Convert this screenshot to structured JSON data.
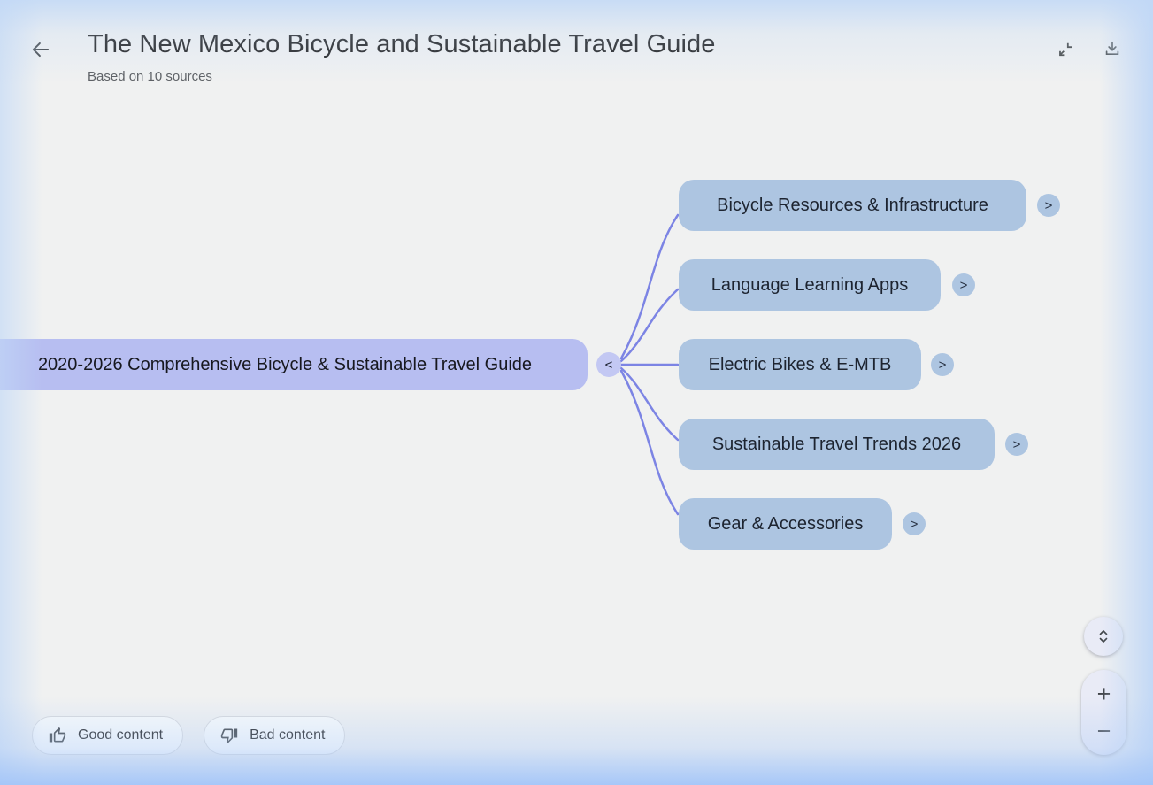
{
  "header": {
    "title": "The New Mexico Bicycle and Sustainable Travel Guide",
    "subtitle": "Based on 10 sources",
    "back_icon": "arrow-left",
    "collapse_icon": "collapse-content",
    "download_icon": "download"
  },
  "mindmap": {
    "root": {
      "label": "2020-2026 Comprehensive Bicycle & Sustainable Travel Guide",
      "collapse_glyph": "<"
    },
    "expand_glyph": ">",
    "children": [
      {
        "label": "Bicycle Resources & Infrastructure"
      },
      {
        "label": "Language Learning Apps"
      },
      {
        "label": "Electric Bikes & E-MTB"
      },
      {
        "label": "Sustainable Travel Trends 2026"
      },
      {
        "label": "Gear & Accessories"
      }
    ],
    "colors": {
      "root_bg": "#b7bef1",
      "child_bg": "#adc5e1",
      "connector": "#7c84e4"
    }
  },
  "feedback": {
    "good_label": "Good content",
    "bad_label": "Bad content",
    "good_icon": "thumb-up",
    "bad_icon": "thumb-down"
  },
  "zoom_controls": {
    "fit_icon": "unfold-chevrons",
    "zoom_in_label": "+",
    "zoom_out_label": "−"
  }
}
